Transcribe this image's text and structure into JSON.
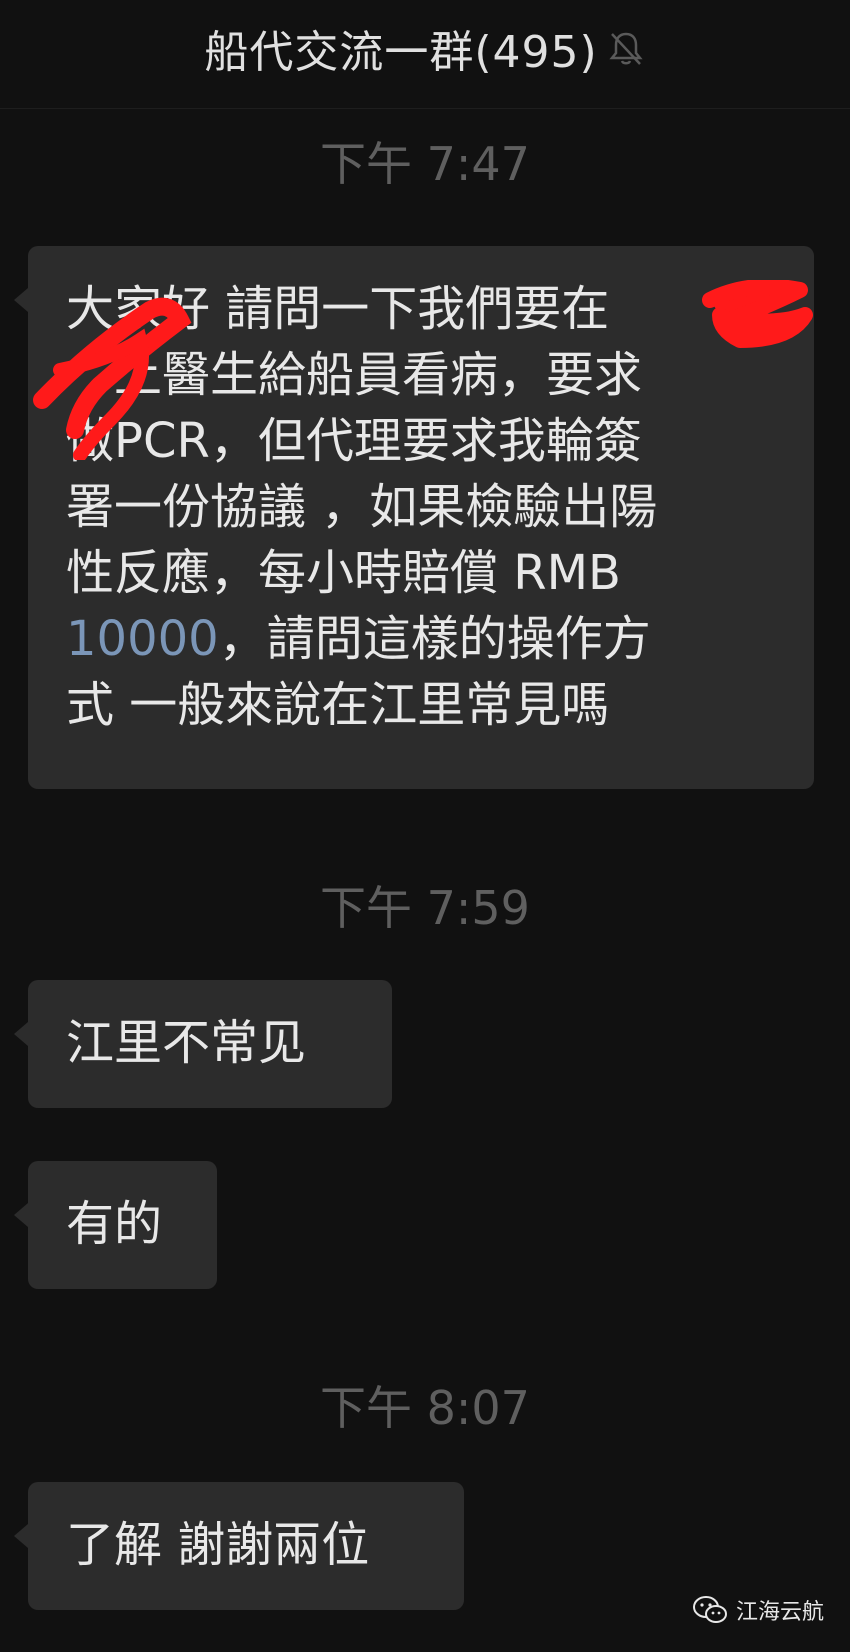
{
  "header": {
    "title": "船代交流一群(495)",
    "mute_icon": "bell-slash-icon"
  },
  "messages": [
    {
      "time": "下午 7:47",
      "text_line1": "大家好 請問一下我們要在",
      "text_line2": "　上醫生給船員看病，要求",
      "text_line3": "做PCR，但代理要求我輪簽",
      "text_line4": "署一份協議 ，如果檢驗出陽",
      "text_line5": "性反應，每小時賠償 RMB",
      "text_line6_link": "10000",
      "text_line6_rest": "，請問這樣的操作方",
      "text_line7": "式 一般來說在江里常見嗎"
    },
    {
      "time": "下午 7:59",
      "text": "江里不常见"
    },
    {
      "text": "有的"
    },
    {
      "time": "下午 8:07",
      "text": "了解 謝謝兩位"
    }
  ],
  "watermark": {
    "text": "江海云航",
    "icon": "wechat-icon"
  },
  "colors": {
    "background": "#111111",
    "bubble": "#2c2c2c",
    "timestamp": "#5f5f5f",
    "link": "#7b96b8",
    "redaction": "#ff1a1a"
  }
}
